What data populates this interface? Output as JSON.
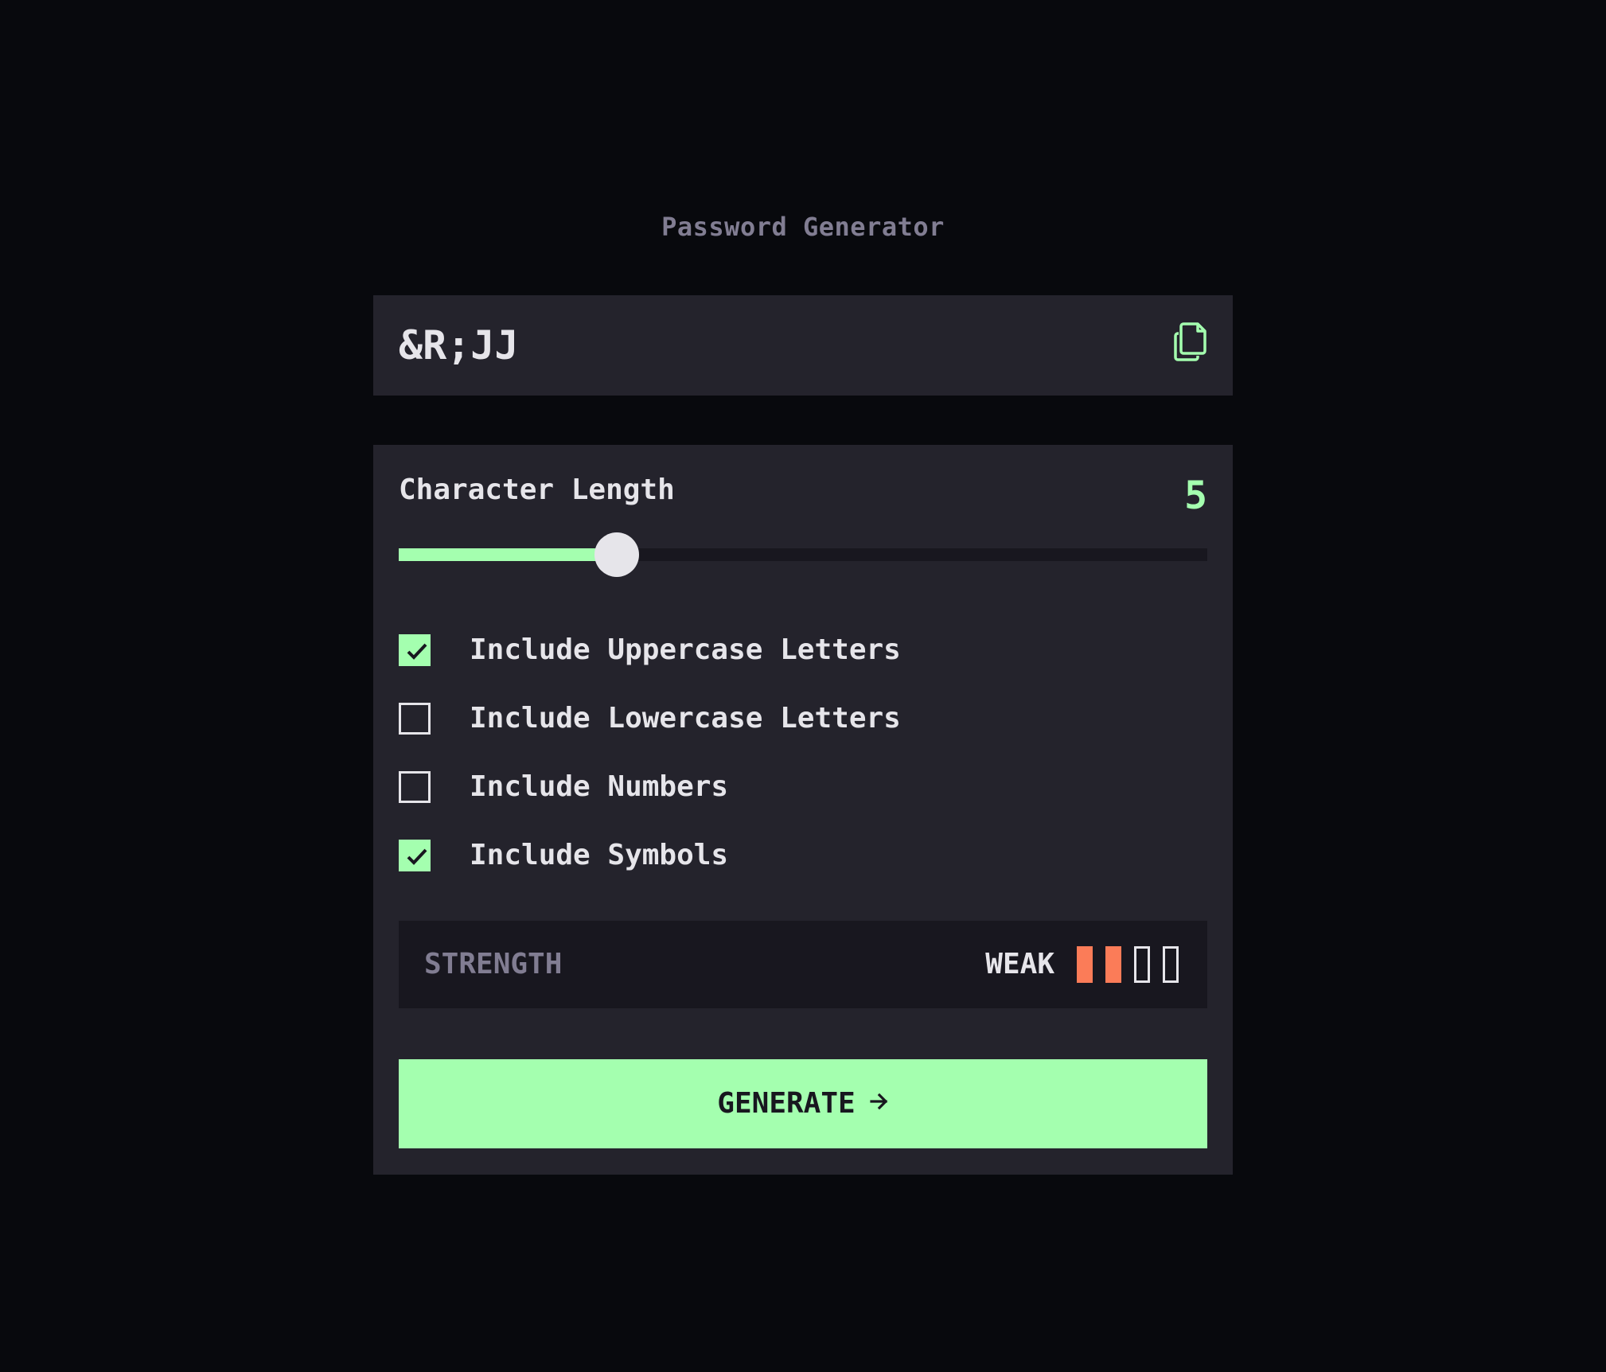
{
  "app": {
    "title": "Password Generator"
  },
  "output": {
    "password": "&R;JJ",
    "copy_icon": "copy-icon"
  },
  "length": {
    "label": "Character Length",
    "value": "5",
    "slider_fraction": 0.27
  },
  "options": [
    {
      "label": "Include Uppercase Letters",
      "checked": true
    },
    {
      "label": "Include Lowercase Letters",
      "checked": false
    },
    {
      "label": "Include Numbers",
      "checked": false
    },
    {
      "label": "Include Symbols",
      "checked": true
    }
  ],
  "strength": {
    "label": "STRENGTH",
    "rating": "WEAK",
    "level": 2,
    "max_level": 4,
    "color": "#fb7c58"
  },
  "generate": {
    "label": "GENERATE",
    "icon": "arrow-right-icon"
  },
  "colors": {
    "accent": "#a4ffaf",
    "panel": "#24232c",
    "background": "#08090d",
    "muted": "#817d92"
  }
}
